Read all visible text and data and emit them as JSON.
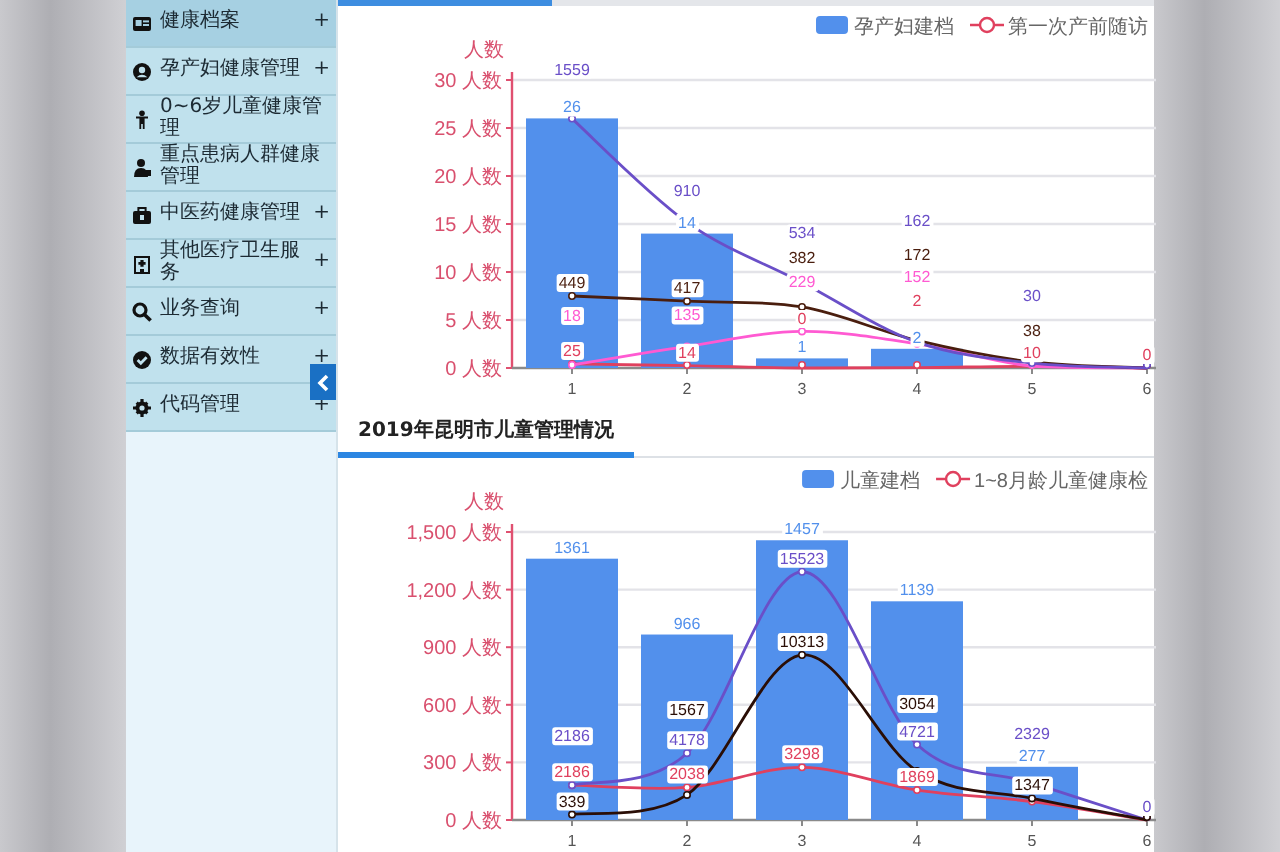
{
  "sidebar": {
    "items": [
      {
        "label": "健康档案",
        "toggle": "+",
        "selected": true
      },
      {
        "label": "孕产妇健康管理",
        "toggle": "+",
        "selected": false
      },
      {
        "label": "0~6岁儿童健康管理",
        "selected": false
      },
      {
        "label": "重点患病人群健康管理",
        "selected": false
      },
      {
        "label": "中医药健康管理",
        "toggle": "+",
        "selected": false
      },
      {
        "label": "其他医疗卫生服务",
        "toggle": "+",
        "selected": false
      },
      {
        "label": "业务查询",
        "toggle": "+",
        "selected": false
      },
      {
        "label": "数据有效性",
        "toggle": "+",
        "selected": false
      },
      {
        "label": "代码管理",
        "toggle": "+",
        "selected": false
      }
    ]
  },
  "charts": [
    {
      "chart_data": {
        "type": "bar",
        "ylabel": "人数",
        "categories": [
          "1",
          "2",
          "3",
          "4",
          "5",
          "6"
        ],
        "ylim": [
          0,
          30
        ],
        "grid": true,
        "yticks": [
          {
            "value": 0,
            "label": "0 人数"
          },
          {
            "value": 5,
            "label": "5 人数"
          },
          {
            "value": 10,
            "label": "10 人数"
          },
          {
            "value": 15,
            "label": "15 人数"
          },
          {
            "value": 20,
            "label": "20 人数"
          },
          {
            "value": 25,
            "label": "25 人数"
          },
          {
            "value": 30,
            "label": "30 人数"
          }
        ],
        "series": [
          {
            "name": "孕产妇建档",
            "color": "#5290ec",
            "values": [
              26,
              14,
              1,
              2,
              0,
              0
            ],
            "value_labels": [
              "26",
              "14",
              "1",
              "2",
              null,
              null
            ]
          }
        ]
      },
      "line_overlays": [
        {
          "name": "第一次产前随访",
          "color": "#e0405e",
          "labels": [
            "25",
            "14",
            "0",
            "2",
            "10",
            "0"
          ]
        },
        {
          "color": "#ff5ad2",
          "labels": [
            "18",
            "135",
            "229",
            "152"
          ]
        },
        {
          "color": "#4a1e0e",
          "labels": [
            "449",
            "417",
            "382",
            "172",
            "38"
          ]
        },
        {
          "color": "#6a4fc8",
          "labels": [
            "1559",
            "910",
            "534",
            "162",
            "30"
          ]
        }
      ]
    },
    {
      "title": "2019年昆明市儿童管理情况",
      "chart_data": {
        "type": "bar",
        "ylabel": "人数",
        "categories": [
          "1",
          "2",
          "3",
          "4",
          "5",
          "6"
        ],
        "ylim": [
          0,
          1500
        ],
        "grid": true,
        "yticks": [
          {
            "value": 0,
            "label": "0 人数"
          },
          {
            "value": 300,
            "label": "300 人数"
          },
          {
            "value": 600,
            "label": "600 人数"
          },
          {
            "value": 900,
            "label": "900 人数"
          },
          {
            "value": 1200,
            "label": "1,200 人数"
          },
          {
            "value": 1500,
            "label": "1,500 人数"
          }
        ],
        "series": [
          {
            "name": "儿童建档",
            "color": "#5290ec",
            "values": [
              1361,
              966,
              1457,
              1139,
              277,
              0
            ],
            "value_labels": [
              "1361",
              "966",
              "1457",
              "1139",
              "277",
              null
            ]
          }
        ]
      },
      "line_overlays": [
        {
          "name": "1~8月龄儿童健康检",
          "color": "#e0405e",
          "labels": [
            "2186",
            "2038",
            "3298",
            "1869"
          ]
        },
        {
          "color": "#6a4fc8",
          "labels": [
            "2186",
            "4178",
            "15523",
            "4721",
            "2329",
            "0"
          ]
        },
        {
          "color": "#2a0e06",
          "labels": [
            "339",
            "1567",
            "10313",
            "3054",
            "1347"
          ]
        }
      ]
    }
  ]
}
